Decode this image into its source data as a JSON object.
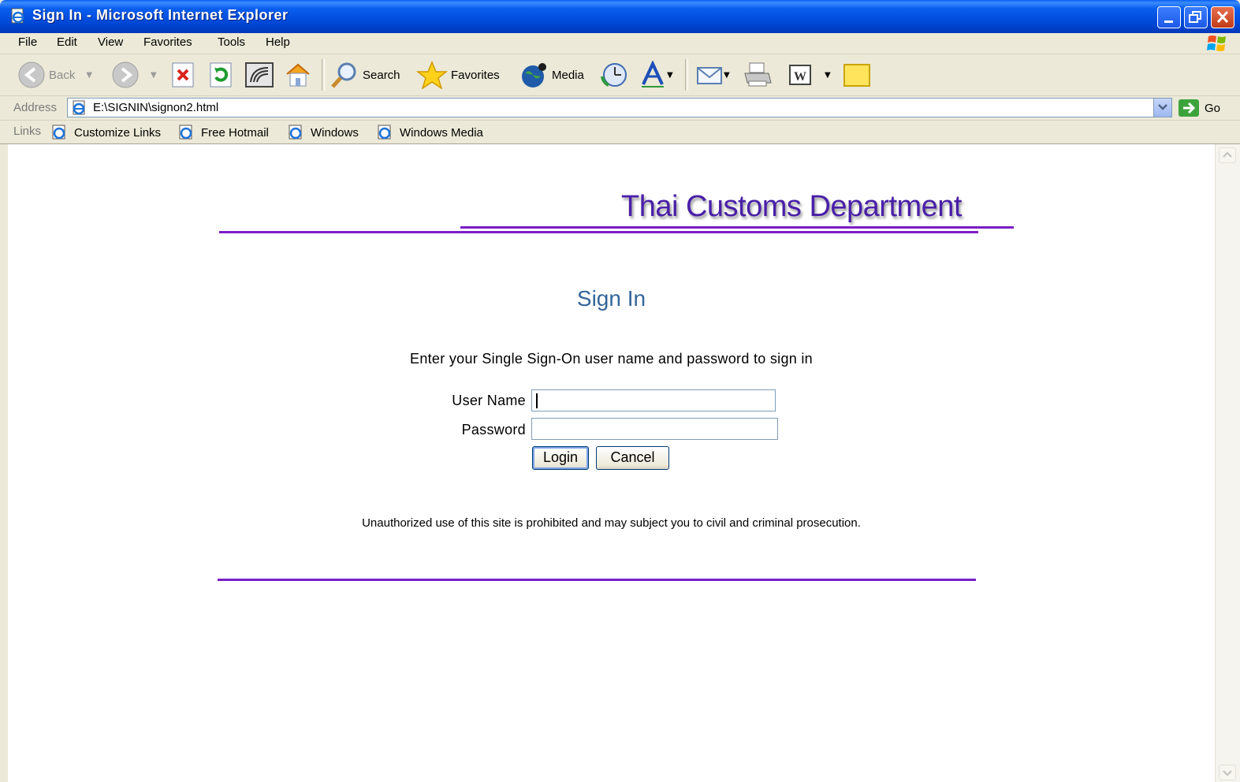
{
  "window": {
    "title": "Sign In - Microsoft Internet Explorer"
  },
  "menu": {
    "items": [
      "File",
      "Edit",
      "View",
      "Favorites",
      "Tools",
      "Help"
    ]
  },
  "toolbar": {
    "back_label": "Back",
    "search_label": "Search",
    "favorites_label": "Favorites",
    "media_label": "Media"
  },
  "address": {
    "label": "Address",
    "url": "E:\\SIGNIN\\signon2.html",
    "go_label": "Go"
  },
  "links": {
    "label": "Links",
    "items": [
      "Customize Links",
      "Free Hotmail",
      "Windows",
      "Windows Media"
    ]
  },
  "page": {
    "banner": "Thai Customs Department",
    "heading": "Sign In",
    "instructions": "Enter your Single Sign-On user name and password to sign in",
    "username_label": "User Name",
    "username_value": "",
    "password_label": "Password",
    "password_value": "",
    "login_label": "Login",
    "cancel_label": "Cancel",
    "warning": "Unauthorized use of this site is prohibited and may subject you to civil and criminal prosecution.",
    "accent_color": "#7a1ec6",
    "heading_color": "#336699",
    "banner_color": "#4a1fa8"
  }
}
